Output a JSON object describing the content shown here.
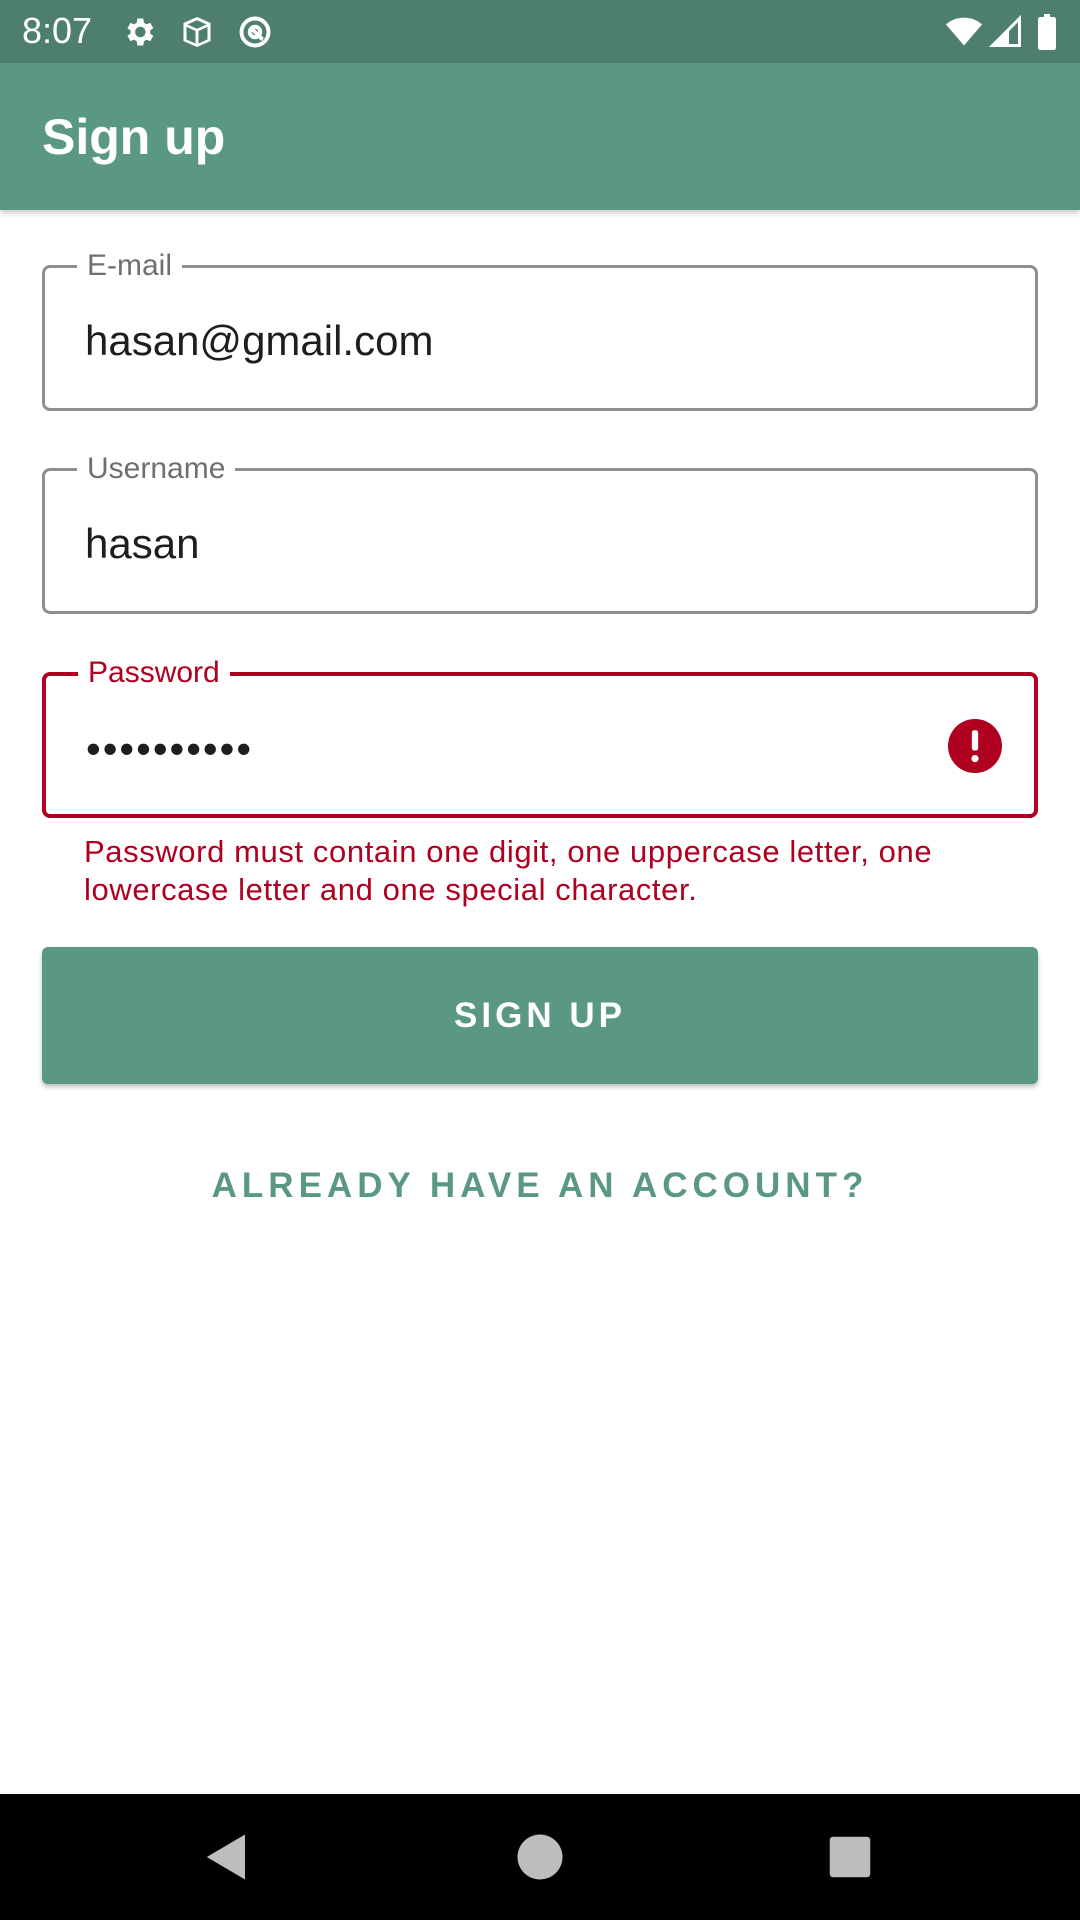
{
  "status_bar": {
    "time": "8:07",
    "icons_left": [
      "settings-icon",
      "package-icon",
      "at-sign-icon"
    ],
    "icons_right": [
      "wifi-icon",
      "cell-signal-icon",
      "battery-icon"
    ]
  },
  "app_bar": {
    "title": "Sign up"
  },
  "form": {
    "email": {
      "label": "E-mail",
      "value": "hasan@gmail.com"
    },
    "username": {
      "label": "Username",
      "value": "hasan"
    },
    "password": {
      "label": "Password",
      "value": "••••••••••",
      "error_icon": "error-icon",
      "error_text": "Password must contain one digit, one uppercase letter, one lowercase letter and one special character."
    }
  },
  "actions": {
    "signup_label": "SIGN UP",
    "login_link_label": "ALREADY HAVE AN ACCOUNT?"
  },
  "nav_bar": {
    "icons": [
      "back-icon",
      "home-icon",
      "recents-icon"
    ]
  },
  "colors": {
    "primary": "#5a9882",
    "primary_dark": "#4e7f6e",
    "error": "#b00020",
    "outline": "#8e8e8e"
  }
}
